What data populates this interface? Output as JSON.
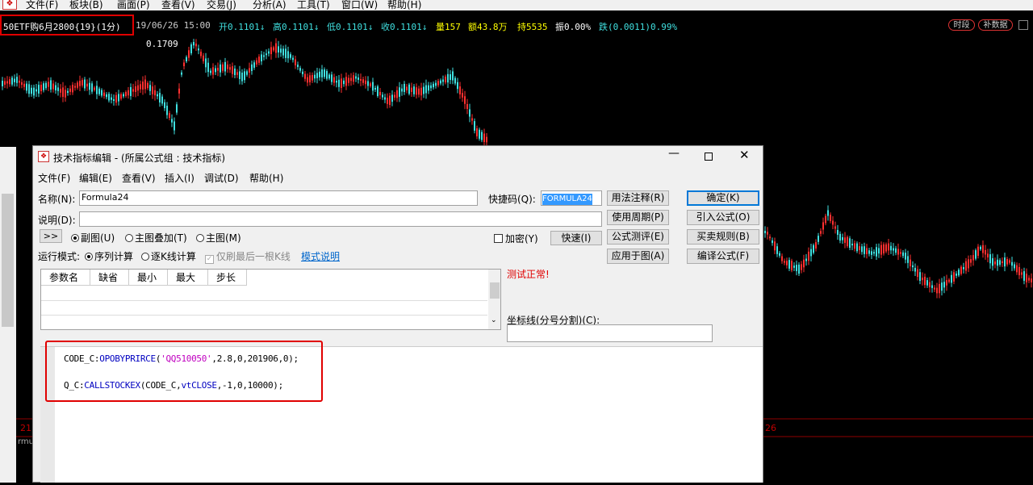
{
  "menu": [
    "文件(F)",
    "板块(B)",
    "画面(P)",
    "查看(V)",
    "交易(J)",
    "分析(A)",
    "工具(T)",
    "窗口(W)",
    "帮助(H)"
  ],
  "quote": {
    "symbol": "50ETF购6月2800{19}(1分)",
    "datetime": "19/06/26 15:00",
    "open": "开0.1101↓",
    "high": "高0.1101↓",
    "low": "低0.1101↓",
    "close": "收0.1101↓",
    "volume": "量157",
    "amount": "额43.8万",
    "hold": "持5535",
    "amplitude": "振0.00%",
    "change": "跌(0.0011)0.99%",
    "btn_time": "时段",
    "btn_restore": "补数据"
  },
  "chart": {
    "high_label": "0.1709",
    "lower_left_label": "21",
    "lower_right_label": "26",
    "side_label": "rmu",
    "colors": {
      "up": "#ff3030",
      "down": "#40e0e0",
      "line": "#c00000"
    }
  },
  "dialog": {
    "title": "技术指标编辑 - (所属公式组 : 技术指标)",
    "menu": [
      "文件(F)",
      "编辑(E)",
      "查看(V)",
      "插入(I)",
      "调试(D)",
      "帮助(H)"
    ],
    "name_label": "名称(N):",
    "name_value": "Formula24",
    "shortcut_label": "快捷码(Q):",
    "shortcut_value": "FORMULA24",
    "desc_label": "说明(D):",
    "desc_value": "",
    "expand_btn": ">>",
    "radio_sub": "副图(U)",
    "radio_overlay": "主图叠加(T)",
    "radio_main": "主图(M)",
    "encrypt_label": "加密(Y)",
    "quick_btn": "快速(I)",
    "run_mode_label": "运行模式:",
    "radio_seq": "序列计算",
    "radio_bar": "逐K线计算",
    "only_last_label": "仅刷最后一根K线",
    "mode_help_link": "模式说明",
    "buttons": [
      "用法注释(R)",
      "使用周期(P)",
      "公式测评(E)",
      "应用于图(A)",
      "确定(K)",
      "引入公式(O)",
      "买卖规则(B)",
      "编译公式(F)"
    ],
    "grid_headers": [
      "参数名",
      "缺省",
      "最小",
      "最大",
      "步长"
    ],
    "status_text": "测试正常!",
    "coord_label": "坐标线(分号分割)(C):",
    "coord_value": "",
    "code": {
      "line1": {
        "var": "CODE_C:",
        "fn": "OPOBYPRIRCE",
        "open": "(",
        "str": "'QQ510050'",
        "args": ",2.8,0,201906,0);"
      },
      "line2": {
        "var": "Q_C:",
        "fn": "CALLSTOCKEX",
        "open": "(CODE_C,",
        "arg": "vtCLOSE",
        "args": ",-1,0,10000);"
      }
    }
  }
}
